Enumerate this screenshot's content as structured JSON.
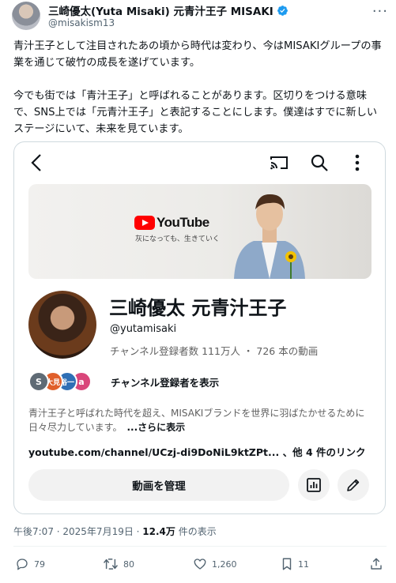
{
  "author": {
    "name": "三崎優太(Yuta Misaki) 元青汁王子 MISAKI",
    "handle": "@misakism13",
    "verified": true
  },
  "post_text": "青汁王子として注目されたあの頃から時代は変わり、今はMISAKIグループの事業を通じて破竹の成長を遂げています。\n\n今でも街では「青汁王子」と呼ばれることがあります。区切りをつける意味で、SNS上では「元青汁王子」と表記することにします。僕達はすでに新しいステージにいて、未来を見ています。",
  "youtube_card": {
    "banner": {
      "logo_text": "YouTube",
      "tagline": "灰になっても、生きていく"
    },
    "channel_name": "三崎優太 元青汁王子",
    "channel_handle": "@yutamisaki",
    "channel_stats": "チャンネル登録者数 111万人 ・ 726 本の動画",
    "subscriber_avatars": [
      {
        "letter": "S",
        "color": "#5f6b75"
      },
      {
        "letter": "大見",
        "color": "#e0602b"
      },
      {
        "letter": "裕一",
        "color": "#2f6fb5"
      },
      {
        "letter": "a",
        "color": "#d9467a"
      }
    ],
    "subscribers_label": "チャンネル登録者を表示",
    "description": "青汁王子と呼ばれた時代を超え、MISAKIブランドを世界に羽ばたかせるために日々尽力しています。",
    "more_label": "...さらに表示",
    "link_text": "youtube.com/channel/UCzj-di9DoNiL9ktZPt... 、他 4 件のリンク",
    "manage_button": "動画を管理"
  },
  "timestamp": {
    "time": "午後7:07 · 2025年7月19日 · ",
    "views": "12.4万",
    "views_suffix": " 件の表示"
  },
  "actions": {
    "replies": "79",
    "reposts": "80",
    "likes": "1,260",
    "bookmarks": "11"
  },
  "colors": {
    "accent": "#1d9bf0",
    "text": "#0f1419",
    "muted": "#536471",
    "youtube_red": "#ff0000"
  }
}
